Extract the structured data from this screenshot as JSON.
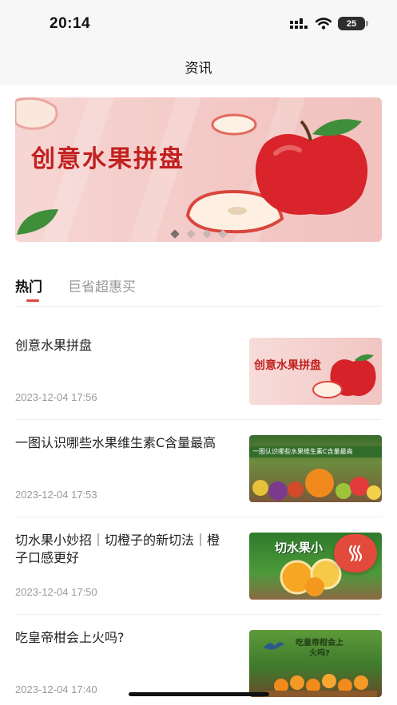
{
  "status_bar": {
    "time": "20:14",
    "battery": "25"
  },
  "header": {
    "title": "资讯"
  },
  "banner": {
    "title": "创意水果拼盘",
    "slide_count": 4,
    "active_slide": 1
  },
  "tabs": [
    {
      "label": "热门",
      "active": true
    },
    {
      "label": "巨省超惠买",
      "active": false
    }
  ],
  "articles": [
    {
      "title": "创意水果拼盘",
      "time": "2023-12-04 17:56",
      "thumb_text": "创意水果拼盘",
      "thumb_theme": "pink"
    },
    {
      "title": "一图认识哪些水果维生素C含量最高",
      "time": "2023-12-04 17:53",
      "thumb_text": "一图认识哪些水果维生素C含量最高",
      "thumb_theme": "market"
    },
    {
      "title": "切水果小妙招｜切橙子的新切法｜橙子口感更好",
      "time": "2023-12-04 17:50",
      "thumb_text": "切水果小",
      "thumb_theme": "green"
    },
    {
      "title": "吃皇帝柑会上火吗?",
      "time": "2023-12-04 17:40",
      "thumb_text": "吃皇帝柑会上火吗?",
      "thumb_theme": "forest"
    }
  ],
  "floating_button": {
    "icon": "heat-wave-icon"
  },
  "colors": {
    "accent": "#e0453c",
    "banner_title": "#c2201f",
    "fab": "#e24a3b"
  }
}
